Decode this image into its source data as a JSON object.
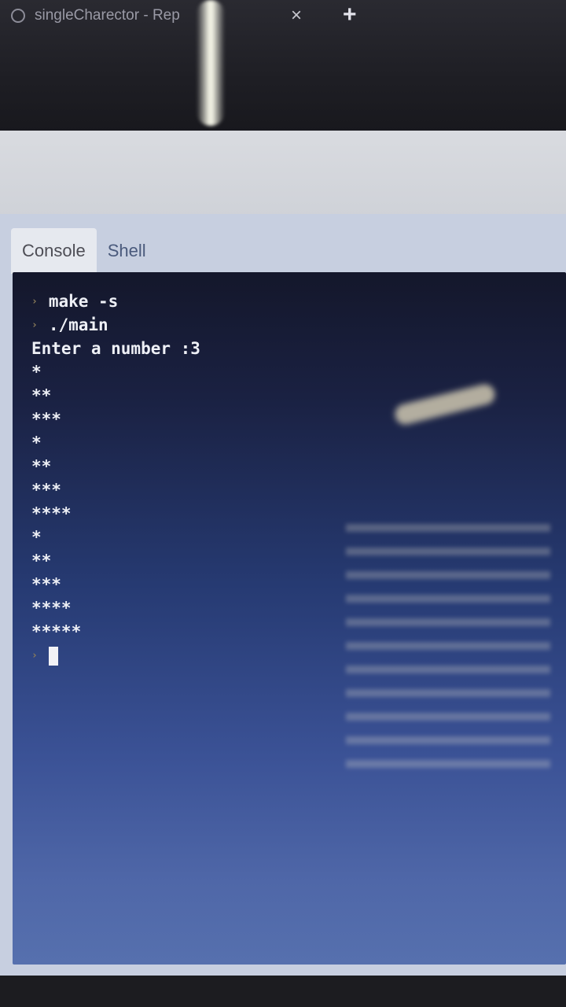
{
  "browser": {
    "tab_title": "singleCharector - Rep",
    "close_glyph": "×",
    "new_tab_glyph": "+"
  },
  "panel_tabs": [
    {
      "label": "Console",
      "active": true
    },
    {
      "label": "Shell",
      "active": false
    }
  ],
  "terminal": {
    "prompt_glyph": "›",
    "lines": [
      {
        "type": "cmd",
        "text": "make -s"
      },
      {
        "type": "cmd",
        "text": "./main"
      },
      {
        "type": "out",
        "text": "Enter a number :3"
      },
      {
        "type": "out",
        "text": "*"
      },
      {
        "type": "out",
        "text": "**"
      },
      {
        "type": "out",
        "text": "***"
      },
      {
        "type": "out",
        "text": "*"
      },
      {
        "type": "out",
        "text": "**"
      },
      {
        "type": "out",
        "text": "***"
      },
      {
        "type": "out",
        "text": "****"
      },
      {
        "type": "out",
        "text": "*"
      },
      {
        "type": "out",
        "text": "**"
      },
      {
        "type": "out",
        "text": "***"
      },
      {
        "type": "out",
        "text": "****"
      },
      {
        "type": "out",
        "text": "*****"
      }
    ]
  },
  "colors": {
    "terminal_top": "#14172b",
    "terminal_bottom": "#5670ae",
    "text": "#eef0f6",
    "prompt": "#8a7c5a"
  }
}
